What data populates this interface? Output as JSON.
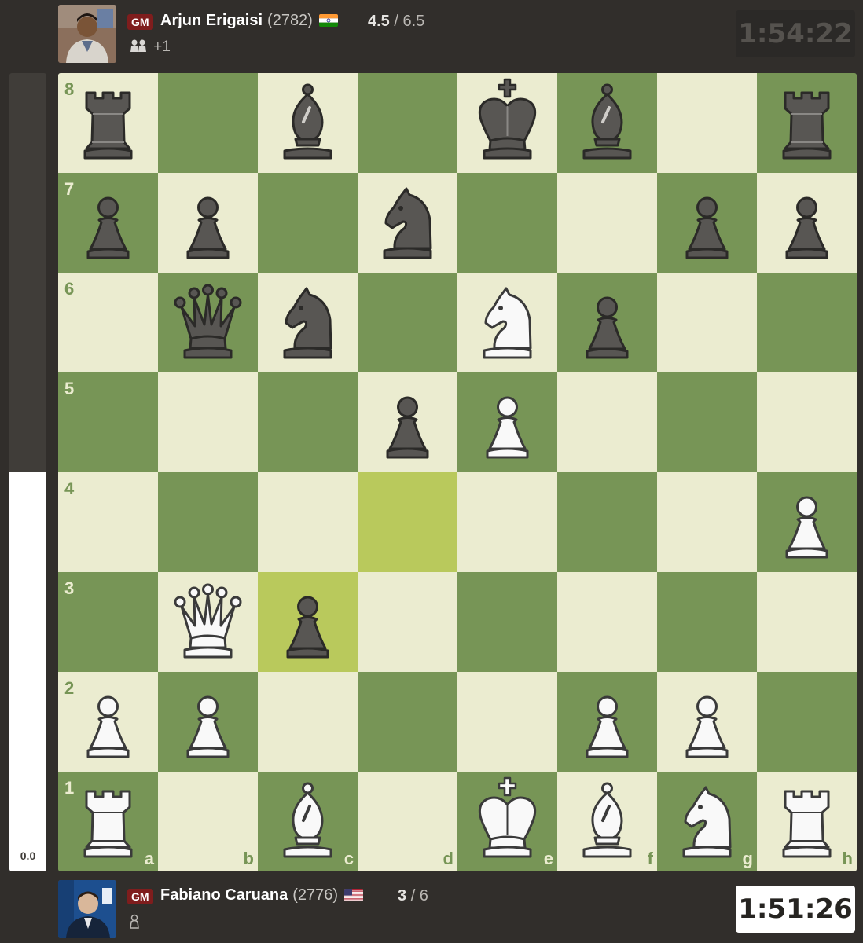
{
  "top_player": {
    "title": "GM",
    "name": "Arjun Erigaisi",
    "rating": "(2782)",
    "country": "India",
    "score_main": "4.5",
    "score_total": "/ 6.5",
    "material": "+1",
    "captured_icons": [
      "white-pawn-icon",
      "white-pawn-icon"
    ],
    "clock": "1:54:22",
    "clock_active": false
  },
  "bottom_player": {
    "title": "GM",
    "name": "Fabiano Caruana",
    "rating": "(2776)",
    "country": "United States",
    "score_main": "3",
    "score_total": "/ 6",
    "captured_icons": [
      "black-pawn-icon"
    ],
    "clock": "1:51:26",
    "clock_active": true
  },
  "evaluation": {
    "score": "0.0",
    "white_fraction": 0.5
  },
  "board": {
    "orientation": "white",
    "colors": {
      "light": "#ebecd0",
      "dark": "#779556",
      "highlight_light": "#c4cf5e",
      "highlight_dark": "#b9c95c"
    },
    "ranks": [
      "8",
      "7",
      "6",
      "5",
      "4",
      "3",
      "2",
      "1"
    ],
    "files": [
      "a",
      "b",
      "c",
      "d",
      "e",
      "f",
      "g",
      "h"
    ],
    "last_move": [
      "d4",
      "c3"
    ],
    "pieces": [
      {
        "square": "a8",
        "piece": "black-rook"
      },
      {
        "square": "c8",
        "piece": "black-bishop"
      },
      {
        "square": "e8",
        "piece": "black-king"
      },
      {
        "square": "f8",
        "piece": "black-bishop"
      },
      {
        "square": "h8",
        "piece": "black-rook"
      },
      {
        "square": "a7",
        "piece": "black-pawn"
      },
      {
        "square": "b7",
        "piece": "black-pawn"
      },
      {
        "square": "d7",
        "piece": "black-knight"
      },
      {
        "square": "g7",
        "piece": "black-pawn"
      },
      {
        "square": "h7",
        "piece": "black-pawn"
      },
      {
        "square": "b6",
        "piece": "black-queen"
      },
      {
        "square": "c6",
        "piece": "black-knight"
      },
      {
        "square": "e6",
        "piece": "white-knight"
      },
      {
        "square": "f6",
        "piece": "black-pawn"
      },
      {
        "square": "d5",
        "piece": "black-pawn"
      },
      {
        "square": "e5",
        "piece": "white-pawn"
      },
      {
        "square": "h4",
        "piece": "white-pawn"
      },
      {
        "square": "b3",
        "piece": "white-queen"
      },
      {
        "square": "c3",
        "piece": "black-pawn"
      },
      {
        "square": "a2",
        "piece": "white-pawn"
      },
      {
        "square": "b2",
        "piece": "white-pawn"
      },
      {
        "square": "f2",
        "piece": "white-pawn"
      },
      {
        "square": "g2",
        "piece": "white-pawn"
      },
      {
        "square": "a1",
        "piece": "white-rook"
      },
      {
        "square": "c1",
        "piece": "white-bishop"
      },
      {
        "square": "e1",
        "piece": "white-king"
      },
      {
        "square": "f1",
        "piece": "white-bishop"
      },
      {
        "square": "g1",
        "piece": "white-knight"
      },
      {
        "square": "h1",
        "piece": "white-rook"
      }
    ]
  }
}
